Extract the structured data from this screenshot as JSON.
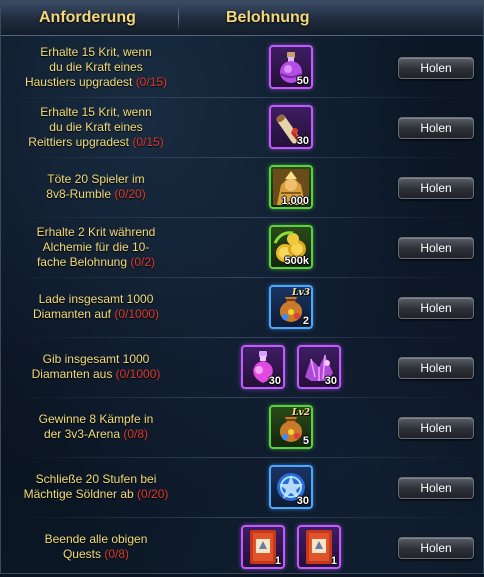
{
  "header": {
    "requirement": "Anforderung",
    "reward": "Belohnung"
  },
  "tasks": [
    {
      "lines": [
        "Erhalte 15 Krit, wenn",
        "du die Kraft eines",
        "Haustiers upgradest"
      ],
      "progress": "(0/15)",
      "button": "Holen",
      "rewards": [
        {
          "icon": "purple-potion-icon",
          "quality": "purple",
          "qty": "50"
        }
      ]
    },
    {
      "lines": [
        "Erhalte 15 Krit, wenn",
        "du die Kraft eines",
        "Reittiers upgradest"
      ],
      "progress": "(0/15)",
      "button": "Holen",
      "rewards": [
        {
          "icon": "scroll-icon",
          "quality": "purple",
          "qty": "30"
        }
      ]
    },
    {
      "lines": [
        "Töte 20 Spieler im",
        "8v8-Rumble"
      ],
      "progress": "(0/20)",
      "button": "Holen",
      "rewards": [
        {
          "icon": "warrior-portrait-icon",
          "quality": "green",
          "qty": "1.000"
        }
      ]
    },
    {
      "lines": [
        "Erhalte 2 Krit während",
        "Alchemie für die 10-",
        "fache Belohnung"
      ],
      "progress": "(0/2)",
      "button": "Holen",
      "rewards": [
        {
          "icon": "gold-coins-icon",
          "quality": "green",
          "qty": "500k"
        }
      ]
    },
    {
      "lines": [
        "Lade insgesamt 1000",
        "Diamanten auf"
      ],
      "progress": "(0/1000)",
      "button": "Holen",
      "rewards": [
        {
          "icon": "treasure-bag-icon",
          "quality": "blue",
          "qty": "2",
          "level": "Lv3"
        }
      ]
    },
    {
      "lines": [
        "Gib insgesamt 1000",
        "Diamanten aus"
      ],
      "progress": "(0/1000)",
      "button": "Holen",
      "rewards": [
        {
          "icon": "pink-potion-icon",
          "quality": "purple",
          "qty": "30"
        },
        {
          "icon": "crystal-cluster-icon",
          "quality": "purple",
          "qty": "30"
        }
      ]
    },
    {
      "lines": [
        "Gewinne 8 Kämpfe in",
        "der 3v3-Arena"
      ],
      "progress": "(0/8)",
      "button": "Holen",
      "rewards": [
        {
          "icon": "treasure-bag-icon",
          "quality": "green",
          "qty": "5",
          "level": "Lv2"
        }
      ]
    },
    {
      "lines": [
        "Schließe 20 Stufen bei",
        "Mächtige Söldner ab"
      ],
      "progress": "(0/20)",
      "button": "Holen",
      "rewards": [
        {
          "icon": "magic-rune-orb-icon",
          "quality": "blue",
          "qty": "30"
        }
      ]
    },
    {
      "lines": [
        "Beende alle obigen",
        "Quests"
      ],
      "progress": "(0/8)",
      "button": "Holen",
      "rewards": [
        {
          "icon": "red-card-icon",
          "quality": "purple",
          "qty": "1"
        },
        {
          "icon": "red-card-icon",
          "quality": "purple",
          "qty": "1"
        }
      ]
    }
  ]
}
